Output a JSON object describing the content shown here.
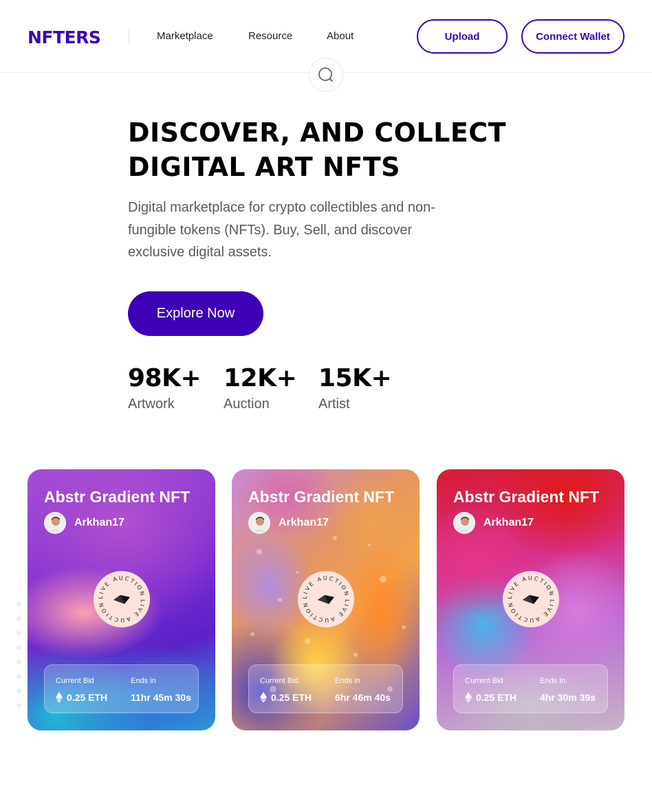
{
  "brand": {
    "logo": "NFTERS",
    "accent": "#3d00b7"
  },
  "nav": {
    "items": [
      {
        "label": "Marketplace"
      },
      {
        "label": "Resource"
      },
      {
        "label": "About"
      }
    ],
    "upload_label": "Upload",
    "connect_label": "Connect Wallet",
    "search_icon": "search-icon"
  },
  "hero": {
    "title_line1": "DISCOVER, AND COLLECT",
    "title_line2": "DIGITAL ART NFTS",
    "description": "Digital marketplace for crypto collectibles and non-fungible tokens (NFTs). Buy, Sell, and discover exclusive digital assets.",
    "cta_label": "Explore Now"
  },
  "stats": [
    {
      "value": "98K+",
      "label": "Artwork"
    },
    {
      "value": "12K+",
      "label": "Auction"
    },
    {
      "value": "15K+",
      "label": "Artist"
    }
  ],
  "cards": [
    {
      "title": "Abstr Gradient NFT",
      "creator": "Arkhan17",
      "badge_text": "LIVE AUCTION",
      "bid_label": "Current Bid",
      "bid_value": "0.25 ETH",
      "ends_label": "Ends in",
      "ends_value": "11hr 45m 30s"
    },
    {
      "title": "Abstr Gradient NFT",
      "creator": "Arkhan17",
      "badge_text": "LIVE AUCTION",
      "bid_label": "Current Bid",
      "bid_value": "0.25 ETH",
      "ends_label": "Ends in",
      "ends_value": "6hr 46m 40s"
    },
    {
      "title": "Abstr Gradient NFT",
      "creator": "Arkhan17",
      "badge_text": "LIVE AUCTION",
      "bid_label": "Current Bid",
      "bid_value": "0.25 ETH",
      "ends_label": "Ends In",
      "ends_value": "4hr 30m 39s"
    }
  ]
}
